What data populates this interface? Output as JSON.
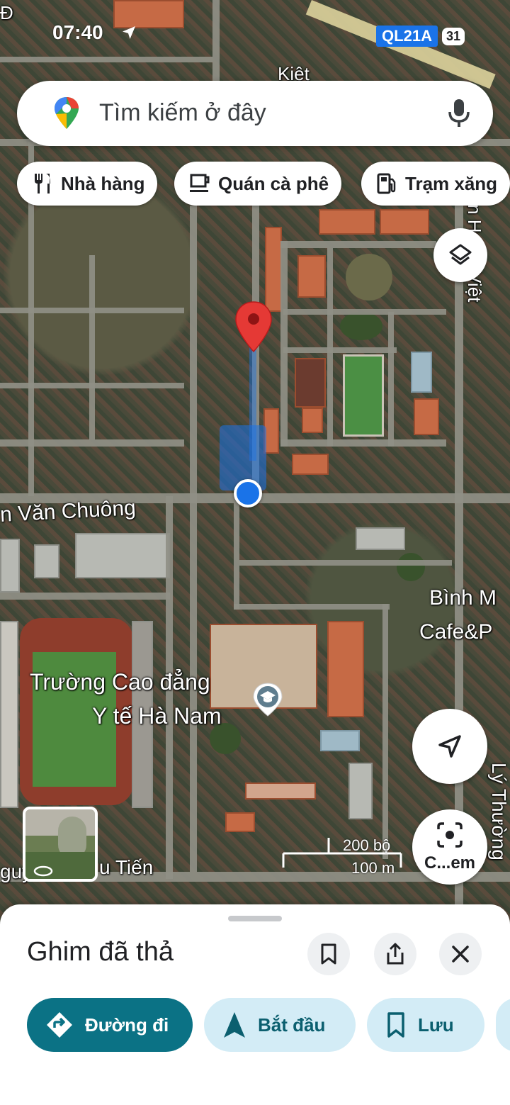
{
  "status_bar": {
    "time": "07:40",
    "road_shield": "QL21A",
    "battery": "31"
  },
  "search": {
    "placeholder": "Tìm kiếm ở đây"
  },
  "chips": [
    {
      "label": "Nhà hàng",
      "icon": "restaurant-icon"
    },
    {
      "label": "Quán cà phê",
      "icon": "coffee-icon"
    },
    {
      "label": "Trạm xăng",
      "icon": "gas-station-icon"
    }
  ],
  "map": {
    "labels": {
      "street_chuong": "n Văn Chuông",
      "street_tien_left": "guy",
      "street_tien_right": "u Tiến",
      "school_line1": "Trường Cao đẳng",
      "school_line2": "Y tế Hà Nam",
      "cafe_line1": "Bình M",
      "cafe_line2": "Cafe&P",
      "top_street": "Kiệt",
      "right_street_top": "Trần Hưng Việt",
      "right_street_bottom": "Lý Thường",
      "top_left_edge": "Đ"
    },
    "lens_label": "C...em",
    "scale": {
      "imperial": "200 bộ",
      "metric": "100 m"
    }
  },
  "sheet": {
    "title": "Ghim đã thả",
    "actions": {
      "directions": "Đường đi",
      "start": "Bắt đầu",
      "save": "Lưu"
    }
  },
  "colors": {
    "primary": "#0b7285",
    "secondary_bg": "#d3ecf6",
    "pin": "#e53935",
    "location": "#1a73e8"
  }
}
